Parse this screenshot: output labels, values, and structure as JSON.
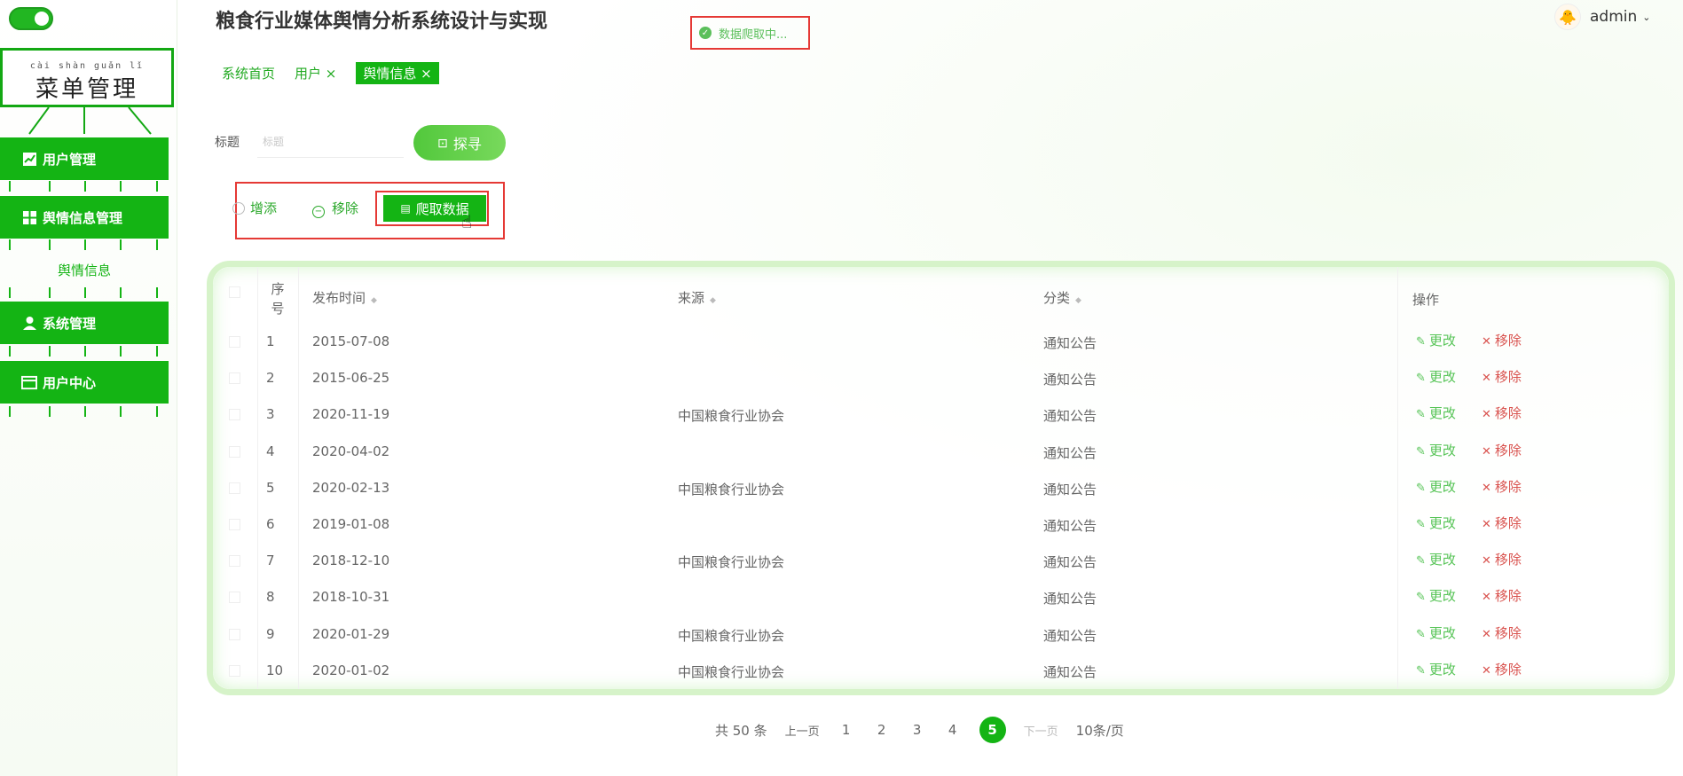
{
  "header": {
    "title": "粮食行业媒体舆情分析系统设计与实现",
    "status": "数据爬取中...",
    "user": "admin"
  },
  "sidebar": {
    "menu_pinyin": "cài shàn guǎn lǐ",
    "menu_title": "菜单管理",
    "items": [
      {
        "label": "用户管理"
      },
      {
        "label": "舆情信息管理"
      },
      {
        "label": "舆情信息"
      },
      {
        "label": "系统管理"
      },
      {
        "label": "用户中心"
      }
    ]
  },
  "tabs": [
    {
      "label": "系统首页"
    },
    {
      "label": "用户 ×"
    },
    {
      "label": "舆情信息 ×"
    }
  ],
  "search": {
    "label": "标题",
    "placeholder": "标题",
    "button": "探寻"
  },
  "actions": {
    "add": "增添",
    "remove": "移除",
    "crawl": "爬取数据"
  },
  "table": {
    "headers": {
      "no_1": "序",
      "no_2": "号",
      "time": "发布时间",
      "source": "来源",
      "category": "分类",
      "ops": "操作"
    },
    "edit_label": "更改",
    "delete_label": "移除",
    "rows": [
      {
        "no": "1",
        "time": "2015-07-08",
        "source": "",
        "category": "通知公告"
      },
      {
        "no": "2",
        "time": "2015-06-25",
        "source": "",
        "category": "通知公告"
      },
      {
        "no": "3",
        "time": "2020-11-19",
        "source": "中国粮食行业协会",
        "category": "通知公告"
      },
      {
        "no": "4",
        "time": "2020-04-02",
        "source": "",
        "category": "通知公告"
      },
      {
        "no": "5",
        "time": "2020-02-13",
        "source": "中国粮食行业协会",
        "category": "通知公告"
      },
      {
        "no": "6",
        "time": "2019-01-08",
        "source": "",
        "category": "通知公告"
      },
      {
        "no": "7",
        "time": "2018-12-10",
        "source": "中国粮食行业协会",
        "category": "通知公告"
      },
      {
        "no": "8",
        "time": "2018-10-31",
        "source": "",
        "category": "通知公告"
      },
      {
        "no": "9",
        "time": "2020-01-29",
        "source": "中国粮食行业协会",
        "category": "通知公告"
      },
      {
        "no": "10",
        "time": "2020-01-02",
        "source": "中国粮食行业协会",
        "category": "通知公告"
      }
    ]
  },
  "pagination": {
    "total": "共 50 条",
    "prev": "上一页",
    "pages": [
      "1",
      "2",
      "3",
      "4",
      "5"
    ],
    "current": "5",
    "next": "下一页",
    "page_size": "10条/页"
  },
  "colors": {
    "accent": "#14b414",
    "danger": "#d9534f",
    "highlight_box": "#e53935"
  }
}
